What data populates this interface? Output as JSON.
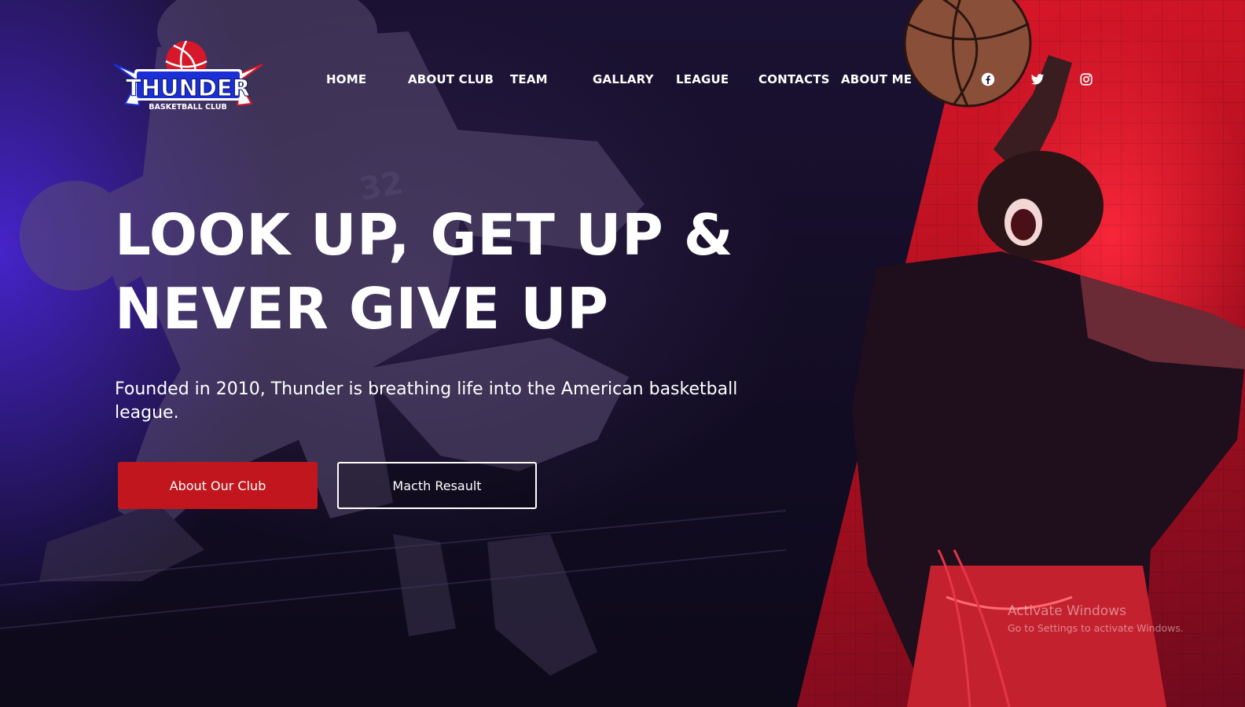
{
  "brand": {
    "name": "THUNDER",
    "tagline": "BASKETBALL CLUB",
    "colors": {
      "blue": "#1b2fd6",
      "red": "#d6182a",
      "navy": "#0b1466"
    }
  },
  "nav": {
    "items": [
      {
        "label": "HOME"
      },
      {
        "label": "ABOUT CLUB"
      },
      {
        "label": "TEAM"
      },
      {
        "label": "GALLARY"
      },
      {
        "label": "LEAGUE"
      },
      {
        "label": "CONTACTS"
      },
      {
        "label": "ABOUT ME"
      }
    ]
  },
  "social": {
    "icons": [
      "facebook-icon",
      "twitter-icon",
      "instagram-icon"
    ]
  },
  "hero": {
    "headline_line1": "LOOK UP, GET UP &",
    "headline_line2": "NEVER GIVE UP",
    "subheadline": "Founded in 2010, Thunder is breathing life into the American basketball league.",
    "primary_button": "About Our Club",
    "secondary_button": "Macth Resault"
  },
  "watermark": {
    "title": "Activate Windows",
    "subtitle": "Go to Settings to activate Windows."
  },
  "theme": {
    "accent_red": "#c1161d",
    "panel_red": "#e0182c",
    "bg_purple": "#1b1233",
    "glow_blue": "#4e28e6"
  }
}
